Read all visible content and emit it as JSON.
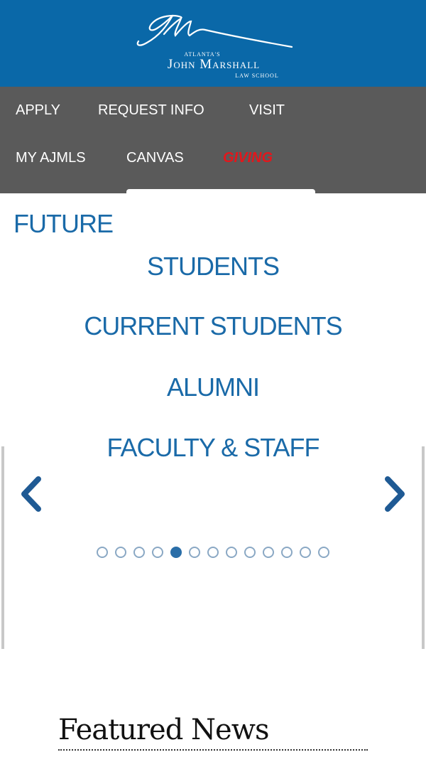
{
  "header": {
    "logo_small": "ATLANTA'S",
    "logo_main": "John Marshall",
    "logo_sub": "LAW SCHOOL",
    "bg_color": "#0a68a8"
  },
  "nav": {
    "apply": "APPLY",
    "request_info": "REQUEST INFO",
    "visit": "VISIT",
    "my_ajmls": "MY AJMLS",
    "canvas": "CANVAS",
    "giving": "GIVING",
    "giving_color": "#e2171c"
  },
  "audience": {
    "future": "FUTURE",
    "students": "STUDENTS",
    "current_students": "CURRENT STUDENTS",
    "alumni": "ALUMNI",
    "faculty_staff": "FACULTY & STAFF",
    "color": "#1a6aa8"
  },
  "carousel": {
    "prev_icon": "chevron-left-icon",
    "next_icon": "chevron-right-icon",
    "dot_count": 13,
    "active_index": 4
  },
  "featured": {
    "title": "Featured News"
  }
}
